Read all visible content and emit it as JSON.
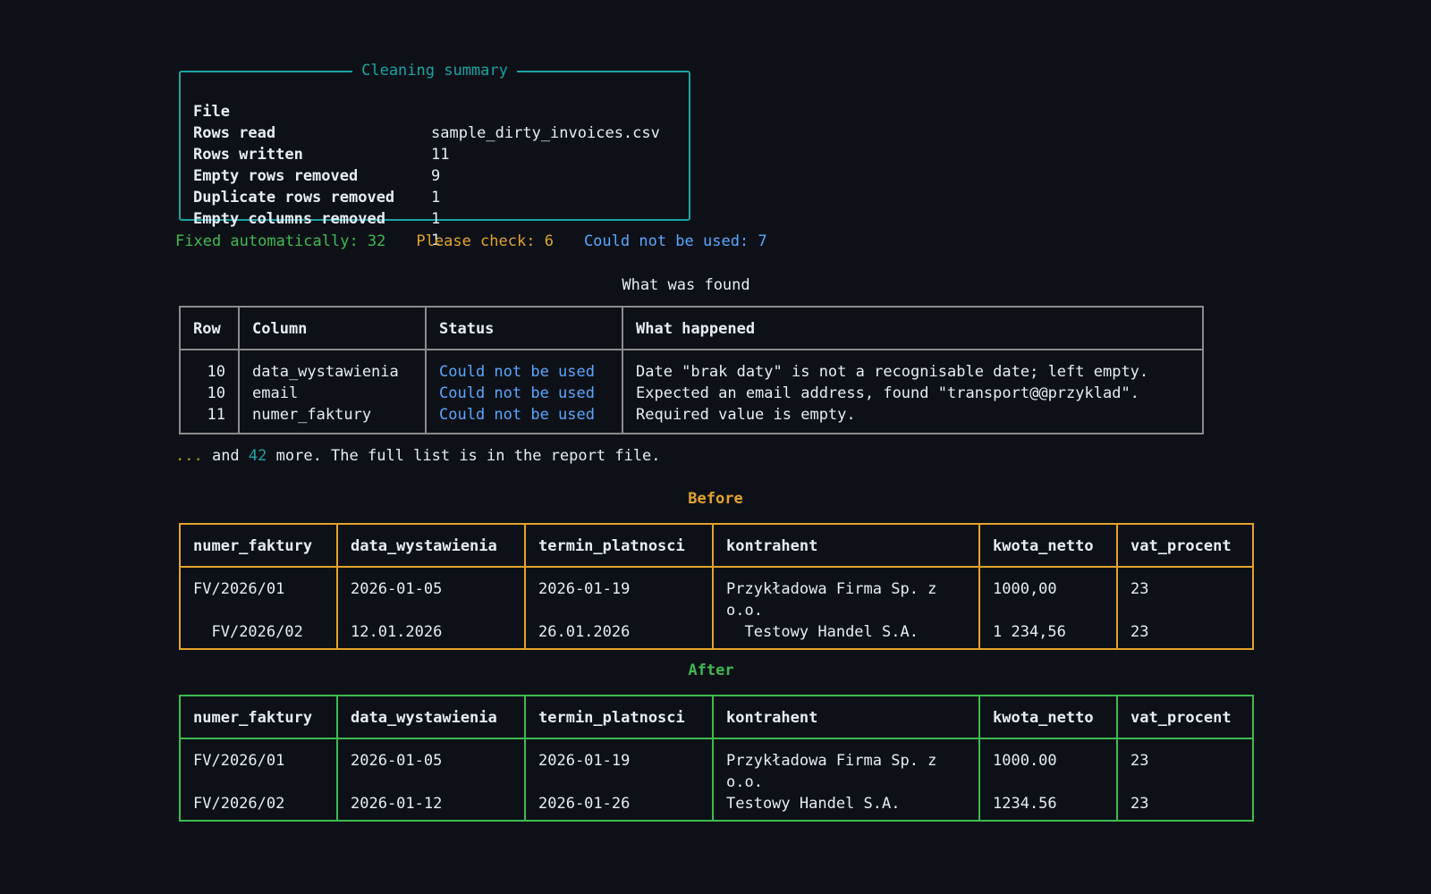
{
  "summary": {
    "title": "Cleaning summary",
    "rows": [
      {
        "key": "File",
        "value": "sample_dirty_invoices.csv"
      },
      {
        "key": "Rows read",
        "value": "11"
      },
      {
        "key": "Rows written",
        "value": "9"
      },
      {
        "key": "Empty rows removed",
        "value": "1"
      },
      {
        "key": "Duplicate rows removed",
        "value": "1"
      },
      {
        "key": "Empty columns removed",
        "value": "1"
      }
    ]
  },
  "counts": {
    "fixed": "Fixed automatically: 32",
    "check": "Please check: 6",
    "unused": "Could not be used: 7"
  },
  "colors": {
    "background": "#0d1117",
    "text": "#e6edf3",
    "teal": "#1aa3a3",
    "green": "#3fb950",
    "orange": "#e3a32a",
    "blue": "#58a6ff",
    "gray_border": "#8b8b8b"
  },
  "found": {
    "title": "What was found",
    "headers": [
      "Row",
      "Column",
      "Status",
      "What happened"
    ],
    "rows": [
      [
        "10",
        "data_wystawienia",
        "Could not be used",
        "Date \"brak daty\" is not a recognisable date; left empty."
      ],
      [
        "10",
        "email",
        "Could not be used",
        "Expected an email address, found \"transport@@przyklad\"."
      ],
      [
        "11",
        "numer_faktury",
        "Could not be used",
        "Required value is empty."
      ]
    ]
  },
  "more": {
    "dots": "...",
    "before": " and ",
    "count": "42",
    "after": " more. The full list is in the report file."
  },
  "before": {
    "title": "Before",
    "headers": [
      "numer_faktury",
      "data_wystawienia",
      "termin_platnosci",
      "kontrahent",
      "kwota_netto",
      "vat_procent"
    ],
    "rows": [
      [
        "FV/2026/01",
        "2026-01-05",
        "2026-01-19",
        "Przykładowa Firma Sp. z o.o.",
        "1000,00",
        "23"
      ],
      [
        "  FV/2026/02",
        "12.01.2026",
        "26.01.2026",
        "  Testowy Handel S.A.",
        "1 234,56",
        "23"
      ]
    ]
  },
  "after": {
    "title": "After",
    "headers": [
      "numer_faktury",
      "data_wystawienia",
      "termin_platnosci",
      "kontrahent",
      "kwota_netto",
      "vat_procent"
    ],
    "rows": [
      [
        "FV/2026/01",
        "2026-01-05",
        "2026-01-19",
        "Przykładowa Firma Sp. z o.o.",
        "1000.00",
        "23"
      ],
      [
        "FV/2026/02",
        "2026-01-12",
        "2026-01-26",
        "Testowy Handel S.A.",
        "1234.56",
        "23"
      ]
    ]
  }
}
